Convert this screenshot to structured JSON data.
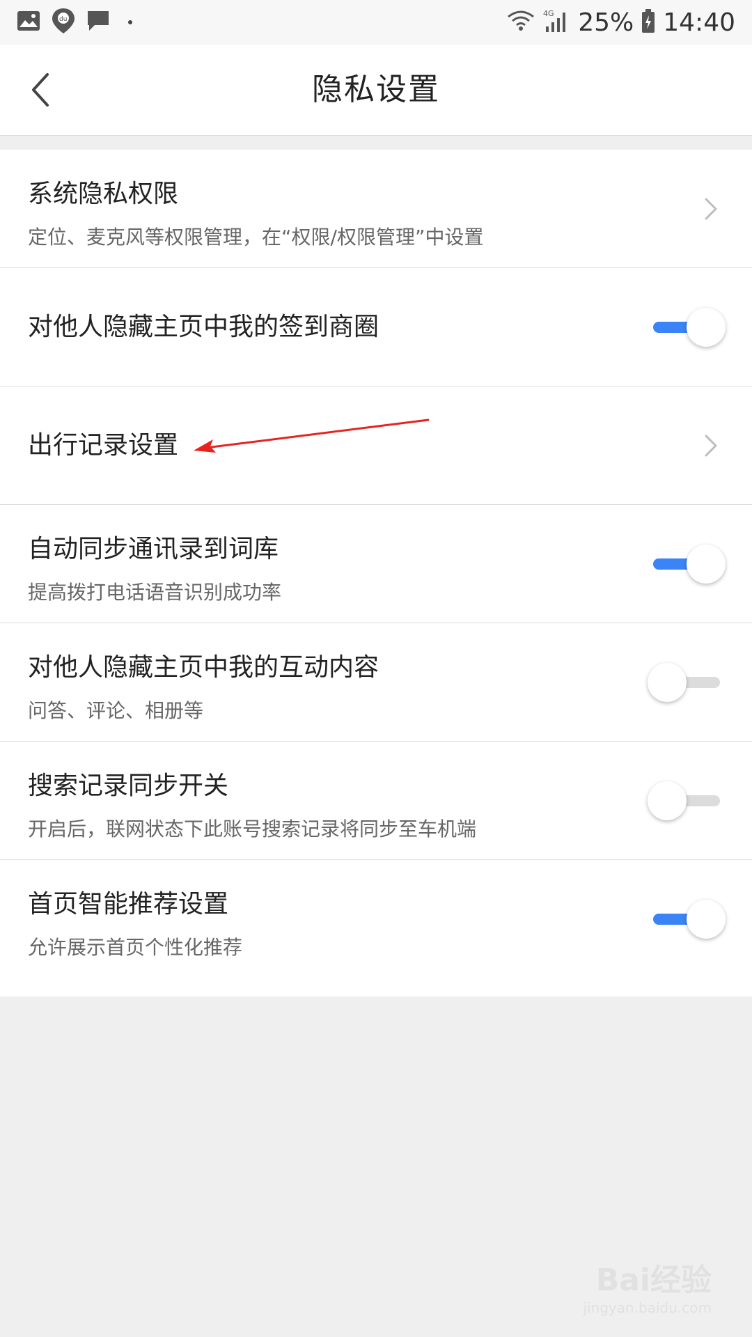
{
  "status_bar": {
    "battery": "25%",
    "time": "14:40",
    "network": "4G",
    "icons_left": [
      "gallery-icon",
      "baidu-map-icon",
      "message-icon"
    ]
  },
  "header": {
    "title": "隐私设置",
    "back_icon": "chevron-left-icon"
  },
  "settings": [
    {
      "title": "系统隐私权限",
      "subtitle": "定位、麦克风等权限管理，在“权限/权限管理”中设置",
      "control": "chevron"
    },
    {
      "title": "对他人隐藏主页中我的签到商圈",
      "control": "toggle",
      "on": true
    },
    {
      "title": "出行记录设置",
      "control": "chevron"
    },
    {
      "title": "自动同步通讯录到词库",
      "subtitle": "提高拨打电话语音识别成功率",
      "control": "toggle",
      "on": true
    },
    {
      "title": "对他人隐藏主页中我的互动内容",
      "subtitle": "问答、评论、相册等",
      "control": "toggle",
      "on": false
    },
    {
      "title": "搜索记录同步开关",
      "subtitle": "开启后，联网状态下此账号搜索记录将同步至车机端",
      "control": "toggle",
      "on": false
    },
    {
      "title": "首页智能推荐设置",
      "subtitle": "允许展示首页个性化推荐",
      "control": "toggle",
      "on": true
    }
  ],
  "watermark": {
    "main": "Bai经验",
    "sub": "jingyan.baidu.com"
  },
  "colors": {
    "toggle_on": "#3b84f5",
    "toggle_off": "#dcdcdc",
    "annotation_arrow": "#e8231f",
    "background": "#efefef"
  }
}
